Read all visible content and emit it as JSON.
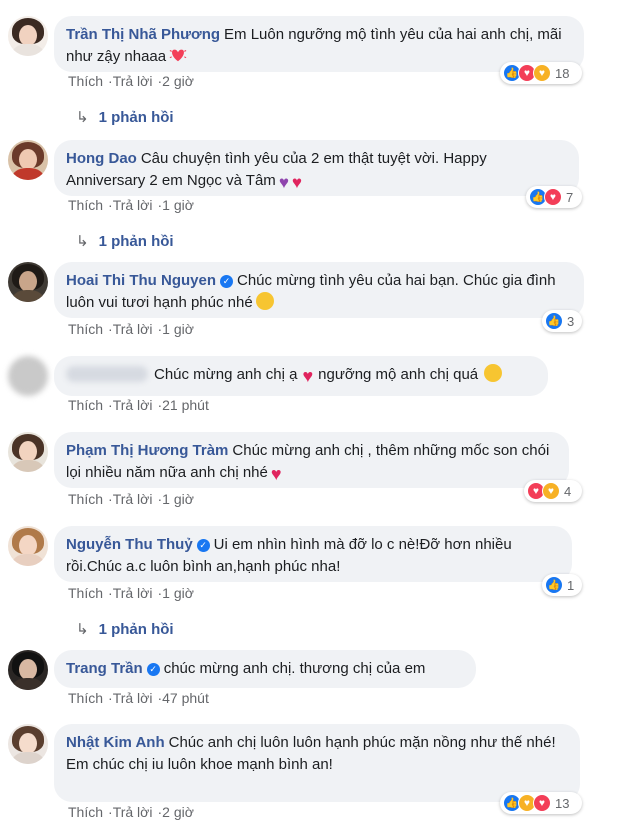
{
  "labels": {
    "like": "Thích",
    "reply": "Trả lời",
    "sep": "·"
  },
  "comments": [
    {
      "author": "Trần Thị Nhã Phương",
      "text": "Em Luôn ngưỡng mộ tình yêu của hai anh chị, mãi như zậy nhaaa",
      "time": "2 giờ",
      "reactions": "18",
      "replies": "1 phản hồi"
    },
    {
      "author": "Hong Dao",
      "text": "Câu chuyện tình yêu của 2 em thật tuyệt vời. Happy Anniversary 2 em Ngọc và Tâm",
      "time": "1 giờ",
      "reactions": "7",
      "replies": "1 phản hồi"
    },
    {
      "author": "Hoai Thi Thu Nguyen",
      "text": "Chúc mừng tình yêu của hai bạn. Chúc gia đình luôn vui tươi hạnh phúc nhé",
      "time": "1 giờ",
      "reactions": "3"
    },
    {
      "author": "",
      "text": "Chúc mừng anh chị ạ",
      "text2": "ngưỡng mộ anh chị quá",
      "time": "21 phút"
    },
    {
      "author": "Phạm Thị Hương Tràm",
      "text": "Chúc mừng anh chị , thêm những mốc son chói lọi nhiều năm nữa anh chị nhé",
      "time": "1 giờ",
      "reactions": "4"
    },
    {
      "author": "Nguyễn Thu Thuỷ",
      "text": "Ui em nhìn hình mà đỡ lo c nè!Đỡ hơn nhiều rồi.Chúc a.c luôn bình an,hạnh phúc nha!",
      "time": "1 giờ",
      "reactions": "1",
      "replies": "1 phản hồi"
    },
    {
      "author": "Trang Trần",
      "text": "chúc mừng anh chị. thương chị của em",
      "time": "47 phút"
    },
    {
      "author": "Nhật Kim Anh",
      "text": "Chúc anh chị luôn luôn hạnh phúc mặn nồng như thế nhé!",
      "text2": "Em chúc chị iu luôn khoe mạnh bình an!",
      "time": "2 giờ",
      "reactions": "13"
    }
  ],
  "icons": {
    "verified": "verified-check-icon",
    "reply_arrow": "reply-arrow-icon",
    "like": "like-reaction-icon",
    "love": "love-reaction-icon",
    "care": "care-reaction-icon"
  },
  "colors": {
    "author": "#385898",
    "bubble": "#f0f2f5",
    "meta": "#65676b",
    "like": "#1877f2",
    "love": "#f33e58"
  }
}
